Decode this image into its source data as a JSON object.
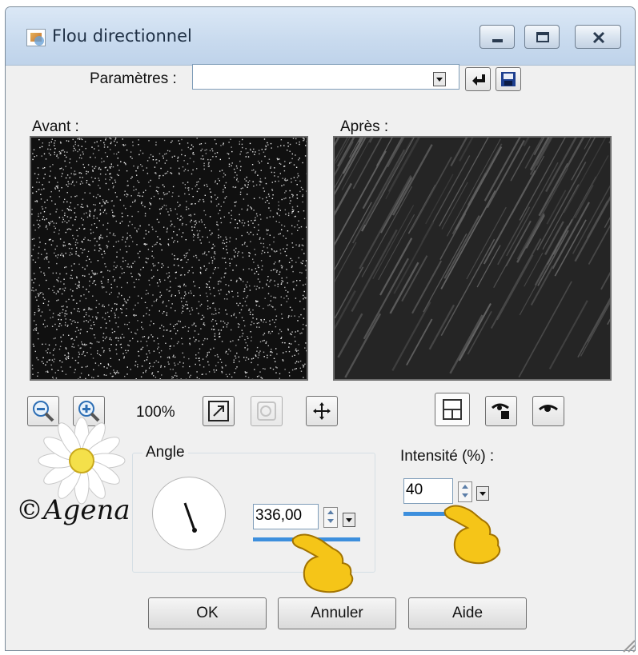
{
  "window": {
    "title": "Flou directionnel"
  },
  "parameters": {
    "label": "Paramètres :",
    "value": ""
  },
  "preview": {
    "before_label": "Avant :",
    "after_label": "Après :",
    "zoom_level": "100%"
  },
  "angle": {
    "group_label": "Angle",
    "value": "336,00"
  },
  "intensity": {
    "label": "Intensité (%) :",
    "value": "40"
  },
  "buttons": {
    "ok": "OK",
    "cancel": "Annuler",
    "help": "Aide"
  },
  "watermark": {
    "text": "©Agena"
  },
  "colors": {
    "window_bg": "#f0f0f0",
    "accent": "#3d8fdd",
    "titlebar": "#c8daee"
  },
  "icons": [
    "app-icon",
    "minimize-icon",
    "maximize-icon",
    "close-icon",
    "reset-icon",
    "save-icon",
    "zoom-out-icon",
    "zoom-in-icon",
    "fit-icon",
    "hand-icon",
    "move-icon",
    "preview-toggle-icon",
    "eye-lock-icon",
    "eye-icon",
    "daisy-flower",
    "pointing-hand"
  ]
}
